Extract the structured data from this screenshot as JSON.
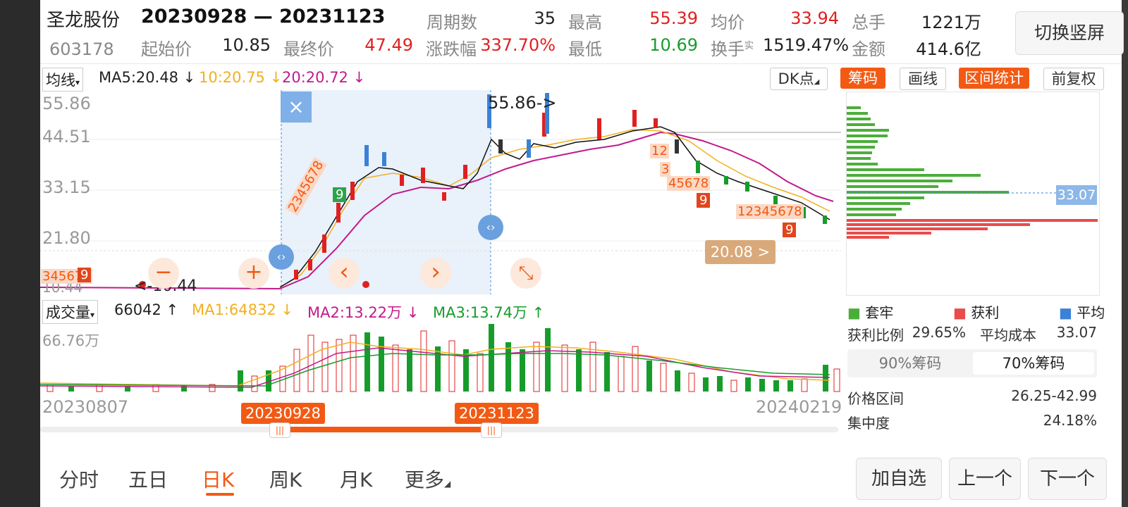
{
  "header": {
    "stock_name": "圣龙股份",
    "stock_code": "603178",
    "range_text": "20230928 — 20231123",
    "stats": {
      "period_label": "周期数",
      "period_value": "35",
      "high_label": "最高",
      "high_value": "55.39",
      "avg_label": "均价",
      "avg_value": "33.94",
      "total_hands_label": "总手",
      "total_hands_value": "1221万",
      "start_label": "起始价",
      "start_value": "10.85",
      "end_label": "最终价",
      "end_value": "47.49",
      "change_label": "涨跌幅",
      "change_value": "337.70%",
      "low_label": "最低",
      "low_value": "10.69",
      "turnover_label": "换手",
      "turnover_sup": "实",
      "turnover_value": "1519.47%",
      "amount_label": "金额",
      "amount_value": "414.6亿"
    },
    "switch_button": "切换竖屏"
  },
  "ma_bar": {
    "select_label": "均线",
    "ma5": "MA5:20.48 ↓",
    "ma10": "10:20.75 ↓",
    "ma20": "20:20.72 ↓",
    "dk_label": "DK点",
    "chip_label": "筹码",
    "draw_label": "画线",
    "interval_label": "区间统计",
    "fq_label": "前复权"
  },
  "price_chart": {
    "y_ticks": [
      "55.86",
      "44.51",
      "33.15",
      "21.80",
      "10.44"
    ],
    "max_marker": "55.86->",
    "min_marker": "<-10.44",
    "price_tag": "20.08 >",
    "avg_cost_tag": "33.07",
    "close_symbol": "×",
    "minus_symbol": "−",
    "plus_symbol": "+",
    "prev_symbol": "‹",
    "next_symbol": "›",
    "collapse_symbol": "⤡",
    "seq_labels": [
      "345678",
      "9",
      "2345678",
      "9",
      "12",
      "3",
      "45678",
      "9",
      "12345678",
      "9"
    ]
  },
  "volume_bar": {
    "select_label": "成交量",
    "current": "66042 ↑",
    "ma1": "MA1:64832 ↓",
    "ma2": "MA2:13.22万 ↓",
    "ma3": "MA3:13.74万 ↑",
    "max_label": "66.76万"
  },
  "timeline": {
    "start_date": "20230807",
    "end_date": "20240219",
    "sel_start": "20230928",
    "sel_end": "20231123"
  },
  "chips_panel": {
    "legend": [
      {
        "label": "套牢",
        "color": "#4cae3a"
      },
      {
        "label": "获利",
        "color": "#e84c4c"
      },
      {
        "label": "平均",
        "color": "#3b82d6"
      }
    ],
    "profit_ratio_label": "获利比例",
    "profit_ratio_value": "29.65%",
    "avg_cost_label": "平均成本",
    "avg_cost_value": "33.07",
    "tab_90": "90%筹码",
    "tab_70": "70%筹码",
    "price_range_label": "价格区间",
    "price_range_value": "26.25-42.99",
    "concentration_label": "集中度",
    "concentration_value": "24.18%"
  },
  "bottom_tabs": [
    {
      "label": "分时",
      "active": false
    },
    {
      "label": "五日",
      "active": false
    },
    {
      "label": "日K",
      "active": true
    },
    {
      "label": "周K",
      "active": false
    },
    {
      "label": "月K",
      "active": false
    },
    {
      "label": "更多",
      "active": false
    }
  ],
  "nav_buttons": {
    "add_watch": "加自选",
    "prev": "上一个",
    "next": "下一个"
  },
  "colors": {
    "accent_orange": "#f25a14",
    "up_red": "#e02020",
    "down_green": "#179c2b",
    "selection_blue": "#4a90d9"
  }
}
